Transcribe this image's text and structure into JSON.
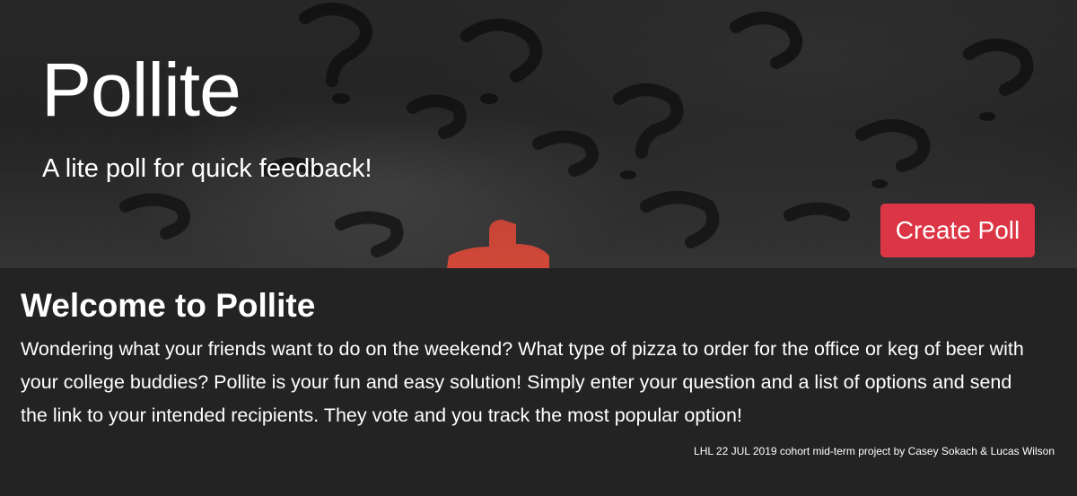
{
  "hero": {
    "title": "Pollite",
    "subtitle": "A lite poll for quick feedback!",
    "create_button_label": "Create Poll",
    "button_color": "#dc3545",
    "background_image": "dark-question-marks-with-red-one"
  },
  "main": {
    "heading": "Welcome to Pollite",
    "description": "Wondering what your friends want to do on the weekend? What type of pizza to order for the office or keg of beer with your college buddies? Pollite is your fun and easy solution! Simply enter your question and a list of options and send the link to your intended recipients. They vote and you track the most popular option!",
    "credits": "LHL 22 JUL 2019 cohort mid-term project by Casey Sokach & Lucas Wilson",
    "background_color": "#232323"
  }
}
